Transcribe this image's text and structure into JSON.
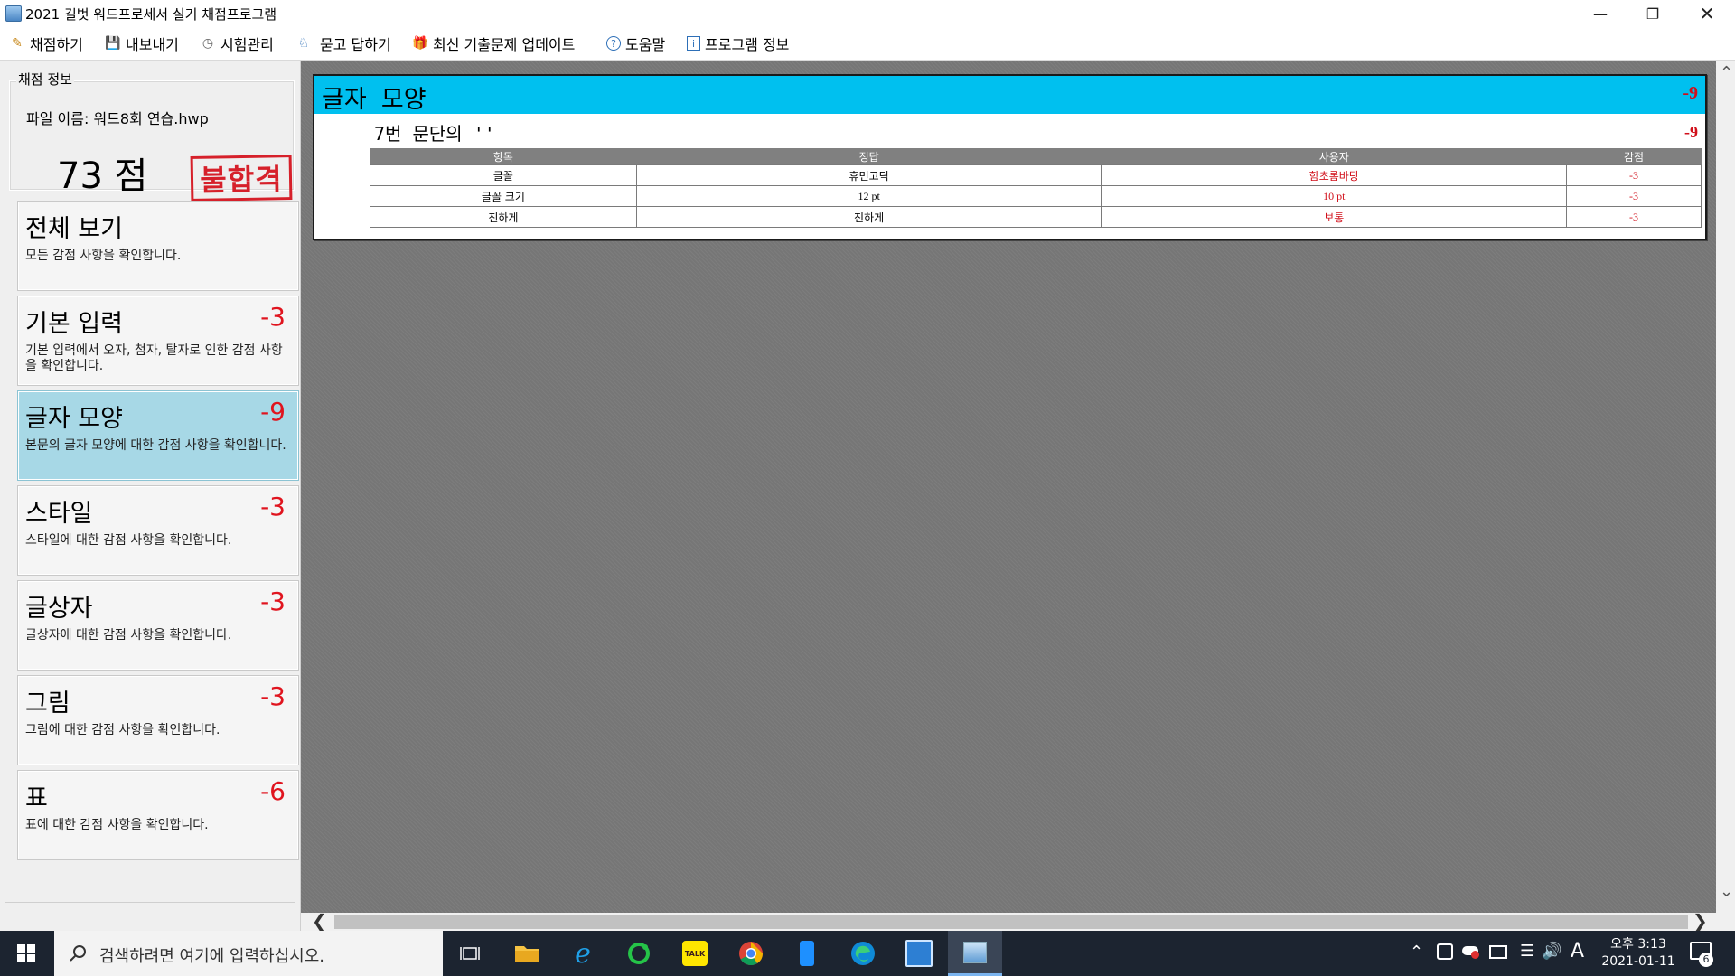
{
  "window": {
    "title": "2021 길벗 워드프로세서 실기 채점프로그램"
  },
  "toolbar": {
    "grade": "채점하기",
    "export": "내보내기",
    "exam_manage": "시험관리",
    "qna": "묻고 답하기",
    "update": "최신 기출문제 업데이트",
    "help": "도움말",
    "info": "프로그램 정보"
  },
  "sidebar": {
    "group_title": "채점 정보",
    "file_name": "파일 이름: 워드8회 연습.hwp",
    "score": "73 점",
    "result": "불합격",
    "categories": [
      {
        "title": "전체 보기",
        "deduct": "",
        "desc": "모든 감점 사항을 확인합니다."
      },
      {
        "title": "기본 입력",
        "deduct": "-3",
        "desc": "기본 입력에서 오자, 첨자, 탈자로 인한 감점 사항을 확인합니다."
      },
      {
        "title": "글자 모양",
        "deduct": "-9",
        "desc": "본문의 글자 모양에 대한 감점 사항을 확인합니다."
      },
      {
        "title": "스타일",
        "deduct": "-3",
        "desc": "스타일에 대한 감점 사항을 확인합니다."
      },
      {
        "title": "글상자",
        "deduct": "-3",
        "desc": "글상자에 대한 감점 사항을 확인합니다."
      },
      {
        "title": "그림",
        "deduct": "-3",
        "desc": "그림에 대한 감점 사항을 확인합니다."
      },
      {
        "title": "표",
        "deduct": "-6",
        "desc": "표에 대한 감점 사항을 확인합니다."
      }
    ]
  },
  "report": {
    "title": "글자 모양",
    "total": "-9",
    "section_title": "7번 문단의 ''",
    "section_deduct": "-9",
    "headers": [
      "항목",
      "정답",
      "사용자",
      "감점"
    ],
    "rows": [
      {
        "item": "글꼴",
        "answer": "휴먼고딕",
        "user": "함초롬바탕",
        "deduct": "-3"
      },
      {
        "item": "글꼴 크기",
        "answer": "12 pt",
        "user": "10 pt",
        "deduct": "-3"
      },
      {
        "item": "진하게",
        "answer": "진하게",
        "user": "보통",
        "deduct": "-3"
      }
    ]
  },
  "taskbar": {
    "search_placeholder": "검색하려면 여기에 입력하십시오.",
    "time": "오후 3:13",
    "date": "2021-01-11",
    "notification_count": "6",
    "ime": "A"
  },
  "colors": {
    "accent": "#00c0ef",
    "deduct": "#d10f1a",
    "active_category": "#a7d8e6"
  }
}
